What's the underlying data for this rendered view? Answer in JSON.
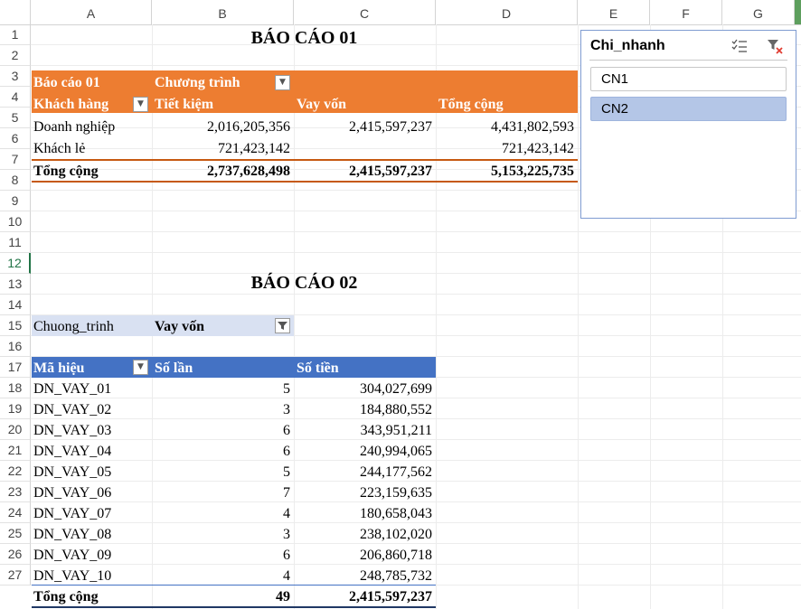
{
  "columns": [
    "A",
    "B",
    "C",
    "D",
    "E",
    "F",
    "G"
  ],
  "rows": [
    "1",
    "2",
    "3",
    "4",
    "5",
    "6",
    "7",
    "8",
    "9",
    "10",
    "11",
    "12",
    "13",
    "14",
    "15",
    "16",
    "17",
    "18",
    "19",
    "20",
    "21",
    "22",
    "23",
    "24",
    "25",
    "26",
    "27"
  ],
  "report1": {
    "title": "BÁO CÁO 01",
    "corner_label": "Báo cáo 01",
    "col_field": "Chương trình",
    "row_field": "Khách hàng",
    "headers": [
      "Tiết kiệm",
      "Vay vốn",
      "Tổng cộng"
    ],
    "rows": [
      {
        "name": "Doanh nghiệp",
        "tiet_kiem": "2,016,205,356",
        "vay_von": "2,415,597,237",
        "tong": "4,431,802,593"
      },
      {
        "name": "Khách lẻ",
        "tiet_kiem": "721,423,142",
        "vay_von": "",
        "tong": "721,423,142"
      }
    ],
    "total": {
      "name": "Tổng cộng",
      "tiet_kiem": "2,737,628,498",
      "vay_von": "2,415,597,237",
      "tong": "5,153,225,735"
    }
  },
  "report2": {
    "title": "BÁO CÁO 02",
    "filter_label": "Chuong_trinh",
    "filter_value": "Vay vốn",
    "headers": [
      "Mã hiệu",
      "Số lần",
      "Số tiền"
    ],
    "rows": [
      {
        "ma": "DN_VAY_01",
        "so_lan": "5",
        "so_tien": "304,027,699"
      },
      {
        "ma": "DN_VAY_02",
        "so_lan": "3",
        "so_tien": "184,880,552"
      },
      {
        "ma": "DN_VAY_03",
        "so_lan": "6",
        "so_tien": "343,951,211"
      },
      {
        "ma": "DN_VAY_04",
        "so_lan": "6",
        "so_tien": "240,994,065"
      },
      {
        "ma": "DN_VAY_05",
        "so_lan": "5",
        "so_tien": "244,177,562"
      },
      {
        "ma": "DN_VAY_06",
        "so_lan": "7",
        "so_tien": "223,159,635"
      },
      {
        "ma": "DN_VAY_07",
        "so_lan": "4",
        "so_tien": "180,658,043"
      },
      {
        "ma": "DN_VAY_08",
        "so_lan": "3",
        "so_tien": "238,102,020"
      },
      {
        "ma": "DN_VAY_09",
        "so_lan": "6",
        "so_tien": "206,860,718"
      },
      {
        "ma": "DN_VAY_10",
        "so_lan": "4",
        "so_tien": "248,785,732"
      }
    ],
    "total": {
      "ma": "Tổng cộng",
      "so_lan": "49",
      "so_tien": "2,415,597,237"
    }
  },
  "slicer": {
    "title": "Chi_nhanh",
    "items": [
      {
        "label": "CN1",
        "selected": false
      },
      {
        "label": "CN2",
        "selected": true
      }
    ],
    "icons": [
      "multi-select-icon",
      "clear-filter-icon"
    ]
  },
  "colors": {
    "orange": "#ed7d31",
    "blue": "#4472c4",
    "slicer_selected": "#b4c6e7"
  }
}
